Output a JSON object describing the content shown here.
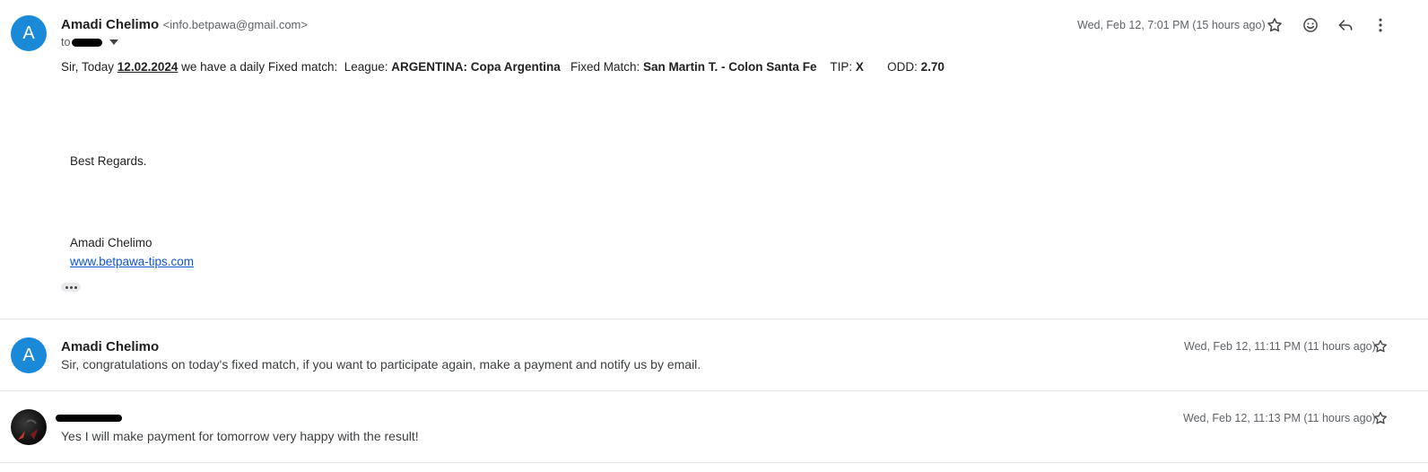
{
  "thread": {
    "expanded": {
      "avatar_letter": "A",
      "sender_name": "Amadi Chelimo",
      "sender_email": "<info.betpawa@gmail.com>",
      "to_label": "to",
      "date": "Wed, Feb 12, 7:01 PM (15 hours ago)",
      "body": {
        "intro": "Sir, Today ",
        "date": "12.02.2024",
        "text1": " we have a daily Fixed match:  League: ",
        "league": "ARGENTINA: Copa Argentina",
        "text2": "   Fixed Match: ",
        "match": "San Martin T. - Colon Santa Fe",
        "tip_label": "    TIP: ",
        "tip": "X",
        "odd_label": "       ODD: ",
        "odd": "2.70",
        "regards": "Best Regards.",
        "signature_name": "Amadi Chelimo",
        "signature_link": "www.betpawa-tips.com"
      }
    },
    "collapsed": [
      {
        "avatar_letter": "A",
        "sender_name": "Amadi Chelimo",
        "date": "Wed, Feb 12, 11:11 PM (11 hours ago)",
        "snippet": "Sir, congratulations on today's fixed match, if you want to participate again, make a payment and notify us by email."
      },
      {
        "sender_name": "",
        "date": "Wed, Feb 12, 11:13 PM (11 hours ago)",
        "snippet": "Yes I will make payment for tomorrow very happy with the result!"
      }
    ]
  },
  "icons": {
    "star": "star-icon",
    "emoji": "emoji-icon",
    "reply": "reply-icon",
    "more": "more-vert-icon"
  }
}
